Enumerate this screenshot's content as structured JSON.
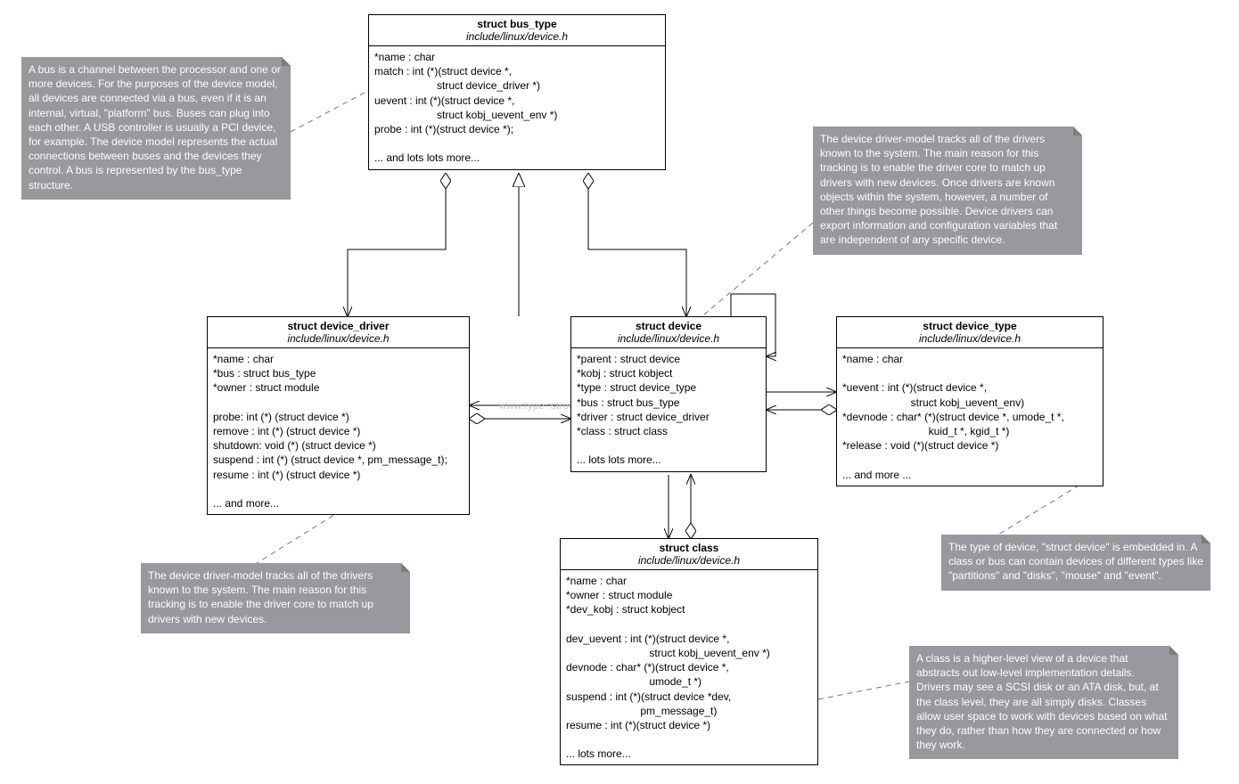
{
  "boxes": {
    "bus_type": {
      "title": "struct bus_type",
      "subtitle": "include/linux/device.h",
      "body": "*name : char\nmatch : int (*)(struct device *,\n                     struct device_driver *)\nuevent : int (*)(struct device *,\n                     struct kobj_uevent_env *)\nprobe : int (*)(struct device *);\n\n... and lots lots more..."
    },
    "device_driver": {
      "title": "struct device_driver",
      "subtitle": "include/linux/device.h",
      "body": "*name : char\n*bus : struct bus_type\n*owner : struct module\n\nprobe: int (*) (struct device *)\nremove : int (*) (struct device *)\nshutdown: void (*) (struct device *)\nsuspend : int (*) (struct device *, pm_message_t);\nresume : int (*) (struct device *)\n\n... and more..."
    },
    "device": {
      "title": "struct device",
      "subtitle": "include/linux/device.h",
      "body": "*parent : struct device\n*kobj : struct kobject\n*type : struct device_type\n*bus : struct bus_type\n*driver : struct device_driver\n*class : struct class\n\n... lots lots more..."
    },
    "device_type": {
      "title": "struct device_type",
      "subtitle": "include/linux/device.h",
      "body": "*name : char\n\n*uevent : int (*)(struct device *,\n                       struct kobj_uevent_env)\n*devnode : char* (*)(struct device *, umode_t *,\n                             kuid_t *, kgid_t *)\n*release : void (*)(struct device *)\n\n... and more ..."
    },
    "class": {
      "title": "struct class",
      "subtitle": "include/linux/device.h",
      "body": "*name : char\n*owner : struct module\n*dev_kobj : struct kobject\n\ndev_uevent : int (*)(struct device *,\n                            struct kobj_uevent_env *)\ndevnode : char* (*)(struct device *,\n                            umode_t *)\nsuspend : int (*)(struct device *dev,\n                         pm_message_t)\nresume : int (*)(struct device *)\n\n... lots more..."
    }
  },
  "notes": {
    "bus": "A bus is a channel between the processor and one or more devices. For the purposes of the device model, all devices are connected via a bus, even if it is an internal, virtual, \"platform\" bus. Buses can plug into each other. A USB controller is usually a PCI device, for example. The device model represents the actual connections between buses and the devices they control. A bus is represented by the bus_type structure.",
    "driver_right": "The device driver-model tracks all of the drivers known to the system. The main reason for this tracking is to enable the driver core to match up drivers with new devices. Once drivers are known objects within the system, however, a number of other things become possible. Device drivers can export information and configuration variables that are independent of any specific device.",
    "driver_left": "The device driver-model tracks all of the drivers known to the system. The main reason for this tracking is to enable the driver core to match up drivers with new devices.",
    "type": "The type of device, \"struct device\" is embedded in. A class or bus can contain devices of different types like \"partitions\" and \"disks\", \"mouse\" and \"event\".",
    "class": "A class is a higher-level view of a device that abstracts out low-level implementation details. Drivers may see a SCSI disk or an ATA disk, but, at the class level, they are all simply disks. Classes allow user space to work with devices based on what they do, rather than how they are connected or how they work."
  },
  "watermark": "www.type :structe"
}
